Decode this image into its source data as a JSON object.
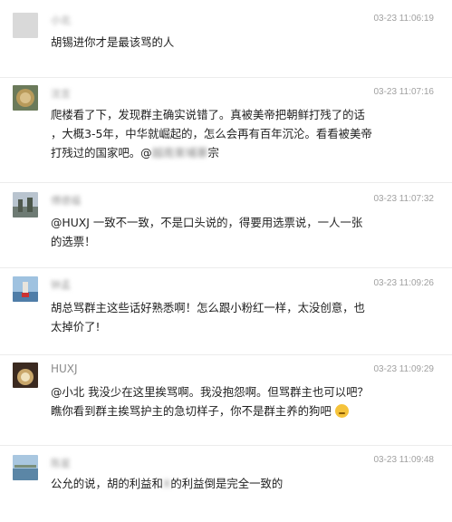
{
  "comments": [
    {
      "name": "小北",
      "time": "03-23 11:06:19",
      "lines": [
        "胡锡进你才是最该骂的人"
      ]
    },
    {
      "name": "沈言",
      "time": "03-23 11:07:16",
      "lines": [
        "爬楼看了下，发现群主确实说错了。真被美帝把朝鲜打残了的话",
        "，大概3-5年，中华就崛起的，怎么会再有百年沉沦。看看被美帝",
        "打残过的国家吧。@"
      ],
      "blurred_word_1": "朝鲜",
      "mention": "越南柬埔寨",
      "suffix": "宗"
    },
    {
      "name": "傅德福",
      "time": "03-23 11:07:32",
      "lines": [
        "@HUXJ 一致不一致，不是口头说的，得要用选票说，一人一张",
        "的选票！"
      ]
    },
    {
      "name": "钟孟",
      "time": "03-23 11:09:26",
      "lines": [
        "胡总骂群主这些话好熟悉啊！怎么跟小粉红一样，太没创意，也",
        "太掉价了!"
      ]
    },
    {
      "name": "HUXJ",
      "time": "03-23 11:09:29",
      "lines": [
        "@小北 我没少在这里挨骂啊。我没抱怨啊。但骂群主也可以吧？",
        "瞧你看到群主挨骂护主的急切样子，你不是群主养的狗吧"
      ],
      "emoji_icon": "thinking-face-emoji"
    },
    {
      "name": "陈星",
      "time": "03-23 11:09:48",
      "lines": [
        "公允的说，胡的利益和",
        "的利益倒是完全一致的"
      ],
      "blurred_word": "X"
    }
  ]
}
